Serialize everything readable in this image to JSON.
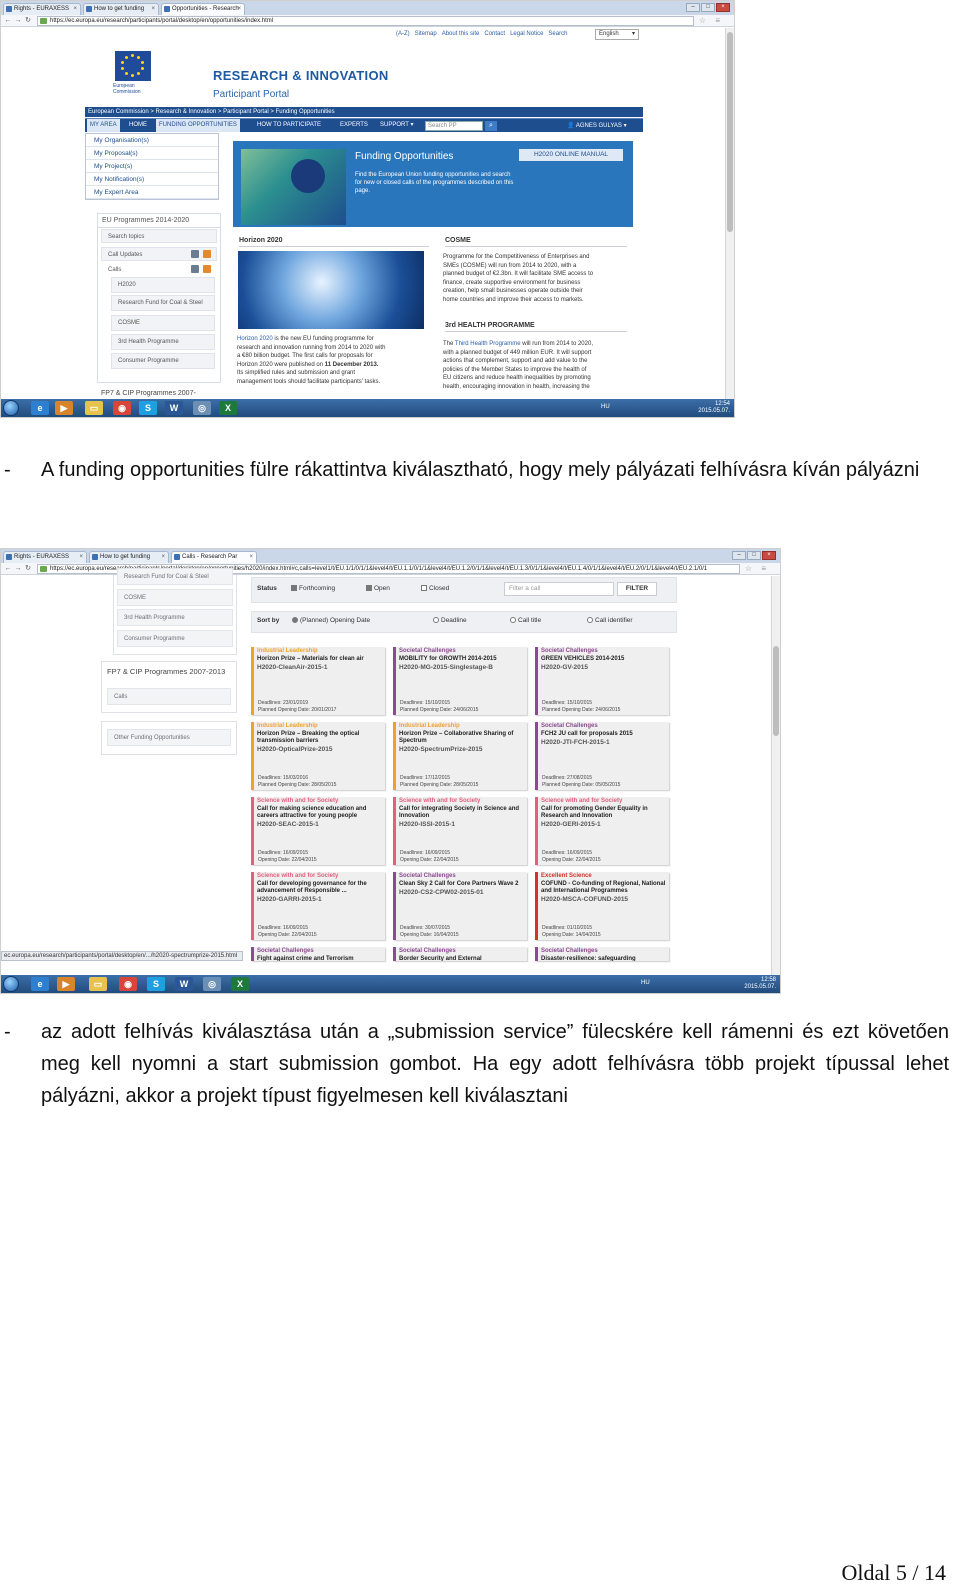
{
  "screenshot1": {
    "tabs": [
      "Rights - EURAXESS",
      "How to get funding",
      "Opportunities - Research"
    ],
    "url": "https://ec.europa.eu/research/participants/portal/desktop/en/opportunities/index.html",
    "top_links": [
      "(A-Z)",
      "Sitemap",
      "About this site",
      "Contact",
      "Legal Notice",
      "Search"
    ],
    "language": "English",
    "logo_text": [
      "European",
      "Commission"
    ],
    "portal_title": "RESEARCH & INNOVATION",
    "portal_subtitle": "Participant Portal",
    "breadcrumb": "European Commission > Research & Innovation > Participant Portal > Funding Opportunities",
    "nav": [
      "MY AREA",
      "HOME",
      "FUNDING OPPORTUNITIES",
      "HOW TO PARTICIPATE",
      "EXPERTS",
      "SUPPORT ▾"
    ],
    "search_placeholder": "Search PP",
    "user": "AGNES GULYAS ▾",
    "my_area_menu": [
      "My Organisation(s)",
      "My Proposal(s)",
      "My Project(s)",
      "My Notification(s)",
      "My Expert Area"
    ],
    "banner": {
      "title": "Funding Opportunities",
      "manual_button": "H2020 ONLINE MANUAL",
      "description": "Find the European Union funding opportunities and search for new or closed calls of the programmes described on this page."
    },
    "sidebar": {
      "heading": "EU Programmes 2014-2020",
      "items": [
        "Search topics",
        "Call Updates",
        "Calls",
        "H2020",
        "Research Fund for Coal & Steel",
        "COSME",
        "3rd Health Programme",
        "Consumer Programme"
      ],
      "heading2": "FP7 & CIP Programmes 2007-"
    },
    "horizon": {
      "heading": "Horizon 2020",
      "text_lines": [
        "is the new EU funding programme for",
        "research and innovation running from 2014 to 2020 with",
        "a €80 billion budget. The first calls for proposals for",
        "Horizon 2020 were published on",
        "Its simplified rules and submission and grant",
        "management tools should facilitate participants' tasks."
      ],
      "link": "Horizon 2020",
      "date": "11 December 2013."
    },
    "cosme": {
      "heading": "COSME",
      "text_lines": [
        "Programme for the Competitiveness of Enterprises and",
        "SMEs (COSME) will run from 2014 to 2020, with a",
        "planned budget of €2.3bn. It will facilitate SME access to",
        "finance, create supportive environment for business",
        "creation, help small businesses operate outside their",
        "home countries and improve their access to markets."
      ]
    },
    "health": {
      "heading": "3rd HEALTH PROGRAMME",
      "link": "Third Health Programme",
      "text_lines": [
        "The",
        "will run from 2014 to 2020,",
        "with a planned budget of 449 million EUR. It will support",
        "actions that complement, support and add value to the",
        "policies of the Member States to improve the health of",
        "EU citizens and reduce health inequalities by promoting",
        "health, encouraging innovation in health, increasing the"
      ]
    },
    "tray": {
      "lang": "HU",
      "time": "12:54",
      "date": "2015.05.07."
    }
  },
  "caption1": {
    "dash": "-",
    "text": "A funding opportunities fülre rákattintva kiválasztható, hogy mely pályázati felhívásra kíván pályázni"
  },
  "screenshot2": {
    "tabs": [
      "Rights - EURAXESS",
      "How to get funding",
      "Calls - Research Par"
    ],
    "url": "https://ec.europa.eu/research/participants/portal/desktop/en/opportunities/h2020/index.html#c,calls=level1/t/EU.1/1/0/1/1&level4/t/EU.1.1/0/1/1&level4/t/EU.1.2/0/1/1&level4/t/EU.1.3/0/1/1&level4/t/EU.1.4/0/1/1&level4/t/EU.2/0/1/1&level4/t/EU.2.1/0/1",
    "sidebar_items": [
      "Research Fund for Coal & Steel",
      "COSME",
      "3rd Health Programme",
      "Consumer Programme"
    ],
    "fp7_heading": "FP7 & CIP Programmes 2007-2013",
    "fp7_calls": "Calls",
    "other_funding": "Other Funding Opportunities",
    "status_label": "Status",
    "status_options": [
      "Forthcoming",
      "Open",
      "Closed"
    ],
    "filter_placeholder": "Filter a call",
    "filter_button": "FILTER",
    "sort_label": "Sort by",
    "sort_options": [
      "(Planned) Opening Date",
      "Deadline",
      "Call title",
      "Call identifier"
    ],
    "cards": [
      {
        "category": "Industrial Leadership",
        "title": "Horizon Prize – Materials for clean air",
        "id": "H2020-CleanAir-2015-1",
        "date1": "Deadlines: 23/01/2019",
        "date2": "Planned Opening Date: 20/01/2017",
        "color": "#f0a030"
      },
      {
        "category": "Societal Challenges",
        "title": "MOBILITY for GROWTH 2014-2015",
        "id": "H2020-MG-2015-Singlestage-B",
        "date1": "Deadlines: 15/10/2015",
        "date2": "Planned Opening Date: 24/06/2015",
        "color": "#8a4b8f"
      },
      {
        "category": "Societal Challenges",
        "title": "GREEN VEHICLES 2014-2015",
        "id": "H2020-GV-2015",
        "date1": "Deadlines: 15/10/2015",
        "date2": "Planned Opening Date: 24/06/2015",
        "color": "#8a4b8f"
      },
      {
        "category": "Industrial Leadership",
        "title": "Horizon Prize – Breaking the optical transmission barriers",
        "id": "H2020-OpticalPrize-2015",
        "date1": "Deadlines: 15/03/2016",
        "date2": "Planned Opening Date: 28/05/2015",
        "color": "#f0a030"
      },
      {
        "category": "Industrial Leadership",
        "title": "Horizon Prize – Collaborative Sharing of Spectrum",
        "id": "H2020-SpectrumPrize-2015",
        "date1": "Deadlines: 17/12/2015",
        "date2": "Planned Opening Date: 28/05/2015",
        "color": "#f0a030"
      },
      {
        "category": "Societal Challenges",
        "title": "FCH2 JU call for proposals 2015",
        "id": "H2020-JTI-FCH-2015-1",
        "date1": "Deadlines: 27/08/2015",
        "date2": "Planned Opening Date: 05/05/2015",
        "color": "#8a4b8f"
      },
      {
        "category": "Science with and for Society",
        "title": "Call for making science education and careers attractive for young people",
        "id": "H2020-SEAC-2015-1",
        "date1": "Deadlines: 16/09/2015",
        "date2": "Opening Date: 22/04/2015",
        "color": "#e0607e"
      },
      {
        "category": "Science with and for Society",
        "title": "Call for integrating Society in Science and Innovation",
        "id": "H2020-ISSI-2015-1",
        "date1": "Deadlines: 16/09/2015",
        "date2": "Opening Date: 22/04/2015",
        "color": "#e0607e"
      },
      {
        "category": "Science with and for Society",
        "title": "Call for promoting Gender Equality in Research and Innovation",
        "id": "H2020-GERI-2015-1",
        "date1": "Deadlines: 16/09/2015",
        "date2": "Opening Date: 22/04/2015",
        "color": "#e0607e"
      },
      {
        "category": "Science with and for Society",
        "title": "Call for developing governance for the advancement of Responsible ...",
        "id": "H2020-GARRI-2015-1",
        "date1": "Deadlines: 16/09/2015",
        "date2": "Opening Date: 22/04/2015",
        "color": "#e0607e"
      },
      {
        "category": "Societal Challenges",
        "title": "Clean Sky 2 Call for Core Partners Wave 2",
        "id": "H2020-CS2-CPW02-2015-01",
        "date1": "Deadlines: 30/07/2015",
        "date2": "Opening Date: 16/04/2015",
        "color": "#8a4b8f"
      },
      {
        "category": "Excellent Science",
        "title": "COFUND - Co-funding of Regional, National and International Programmes",
        "id": "H2020-MSCA-COFUND-2015",
        "date1": "Deadlines: 01/10/2015",
        "date2": "Opening Date: 14/04/2015",
        "color": "#d2332a"
      }
    ],
    "partial_cards": [
      {
        "category": "Societal Challenges",
        "title": "Fight against crime and Terrorism"
      },
      {
        "category": "Societal Challenges",
        "title": "Border Security and External"
      },
      {
        "category": "Societal Challenges",
        "title": "Disaster-resilience: safeguarding"
      }
    ],
    "status_url": "ec.europa.eu/research/participants/portal/desktop/en/.../h2020-spectrumprize-2015.html",
    "tray": {
      "lang": "HU",
      "time": "12:58",
      "date": "2015.05.07."
    }
  },
  "caption2": {
    "dash": "-",
    "text": "az adott felhívás kiválasztása után a „submission service” fülecskére kell rámenni és ezt követően meg kell nyomni a start submission gombot. Ha egy adott felhívásra több projekt típussal lehet pályázni, akkor a projekt típust figyelmesen kell kiválasztani"
  },
  "footer": {
    "page": "Oldal 5 / 14"
  },
  "colors": {
    "ec_blue": "#1e4e8e",
    "banner_blue": "#2a76bd",
    "link_blue": "#2a5ea8"
  }
}
